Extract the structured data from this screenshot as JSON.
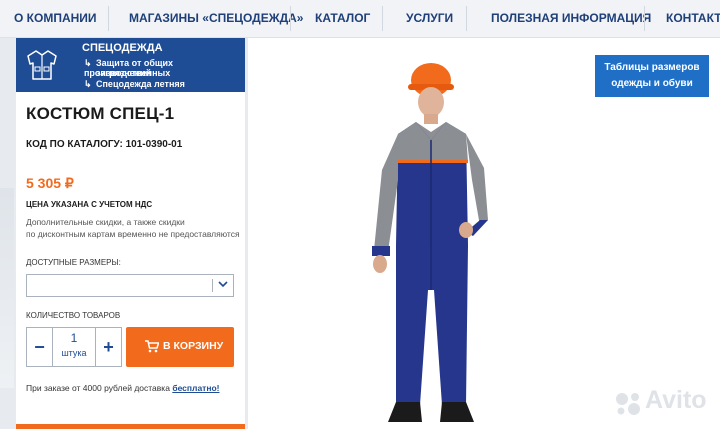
{
  "nav": {
    "items": [
      "О КОМПАНИИ",
      "МАГАЗИНЫ «СПЕЦОДЕЖДА»",
      "КАТАЛОГ",
      "УСЛУГИ",
      "ПОЛЕЗНАЯ ИНФОРМАЦИЯ",
      "КОНТАКТЫ"
    ]
  },
  "category": {
    "title": "СПЕЦОДЕЖДА",
    "sub1_line1": "Защита от общих производственных",
    "sub1_line2": "загрязнений",
    "sub2": "Спецодежда летняя",
    "icon": "jacket-icon"
  },
  "product": {
    "title": "КОСТЮМ СПЕЦ-1",
    "code": "КОД ПО КАТАЛОГУ: 101-0390-01",
    "price": "5 305 ₽",
    "tax_note": "ЦЕНА УКАЗАНА С УЧЕТОМ НДС",
    "discount_line1": "Дополнительные скидки, а также скидки",
    "discount_line2": "по дисконтным картам временно не предоставляются",
    "sizes_label": "ДОСТУПНЫЕ РАЗМЕРЫ:",
    "size_value": "",
    "qty_label": "КОЛИЧЕСТВО ТОВАРОВ",
    "qty_value": "1",
    "qty_unit": "штука",
    "minus": "−",
    "plus": "+",
    "cart_label": "В КОРЗИНУ",
    "delivery_text": "При заказе от 4000 рублей доставка ",
    "delivery_link": "бесплатно!"
  },
  "size_tables": {
    "line1": "Таблицы размеров",
    "line2": "одежды и обуви"
  },
  "watermark": {
    "text": "Avito"
  },
  "colors": {
    "nav_text": "#1e3f78",
    "brand_blue": "#1e4c95",
    "accent_orange": "#f26b1d",
    "button_blue": "#1f6fc7"
  }
}
